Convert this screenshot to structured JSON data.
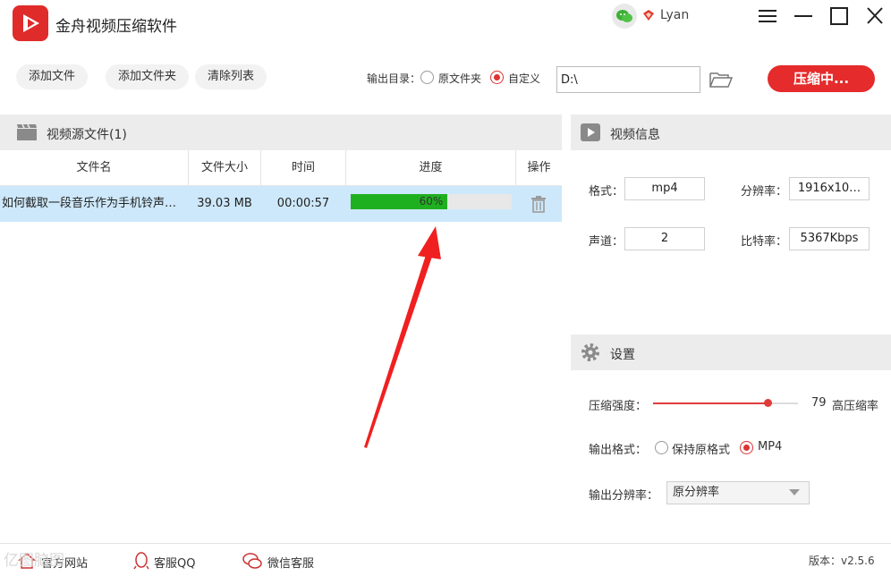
{
  "app": {
    "title": "金舟视频压缩软件"
  },
  "user": {
    "name": "Lyan"
  },
  "toolbar": {
    "add_file": "添加文件",
    "add_folder": "添加文件夹",
    "clear_list": "清除列表",
    "output_label": "输出目录：",
    "output_options": [
      "原文件夹",
      "自定义"
    ],
    "output_selected": "自定义",
    "output_path": "D:\\",
    "compress_button": "压缩中..."
  },
  "source": {
    "title": "视频源文件(1)",
    "columns": [
      "文件名",
      "文件大小",
      "时间",
      "进度",
      "操作"
    ],
    "rows": [
      {
        "name": "如何截取一段音乐作为手机铃声…",
        "size": "39.03 MB",
        "time": "00:00:57",
        "progress": 0.6,
        "progress_label": "60%"
      }
    ]
  },
  "info": {
    "title": "视频信息",
    "format_label": "格式：",
    "format_value": "mp4",
    "resolution_label": "分辨率：",
    "resolution_value": "1916x10…",
    "channel_label": "声道：",
    "channel_value": "2",
    "bitrate_label": "比特率：",
    "bitrate_value": "5367Kbps"
  },
  "settings": {
    "title": "设置",
    "strength_label": "压缩强度：",
    "strength_value": "79",
    "strength_fraction": 0.79,
    "strength_desc": "高压缩率",
    "format_label": "输出格式：",
    "format_options": [
      "保持原格式",
      "MP4"
    ],
    "format_selected": "MP4",
    "resolution_label": "输出分辨率：",
    "resolution_value": "原分辨率"
  },
  "footer": {
    "website": "官方网站",
    "qq": "客服QQ",
    "wechat": "微信客服",
    "version": "版本：v2.5.6"
  },
  "watermark": "亿图脑图",
  "colors": {
    "accent": "#e52b2b",
    "progress": "#1fb01f",
    "row_selected": "#cde8fa"
  },
  "icons": [
    "app-logo-icon",
    "wechat-icon",
    "vip-icon",
    "menu-icon",
    "minimize-icon",
    "maximize-icon",
    "close-icon",
    "folder-icon",
    "film-icon",
    "trash-icon",
    "play-icon",
    "gear-icon",
    "home-icon",
    "qq-icon",
    "wechat-service-icon",
    "red-arrow-annotation"
  ]
}
